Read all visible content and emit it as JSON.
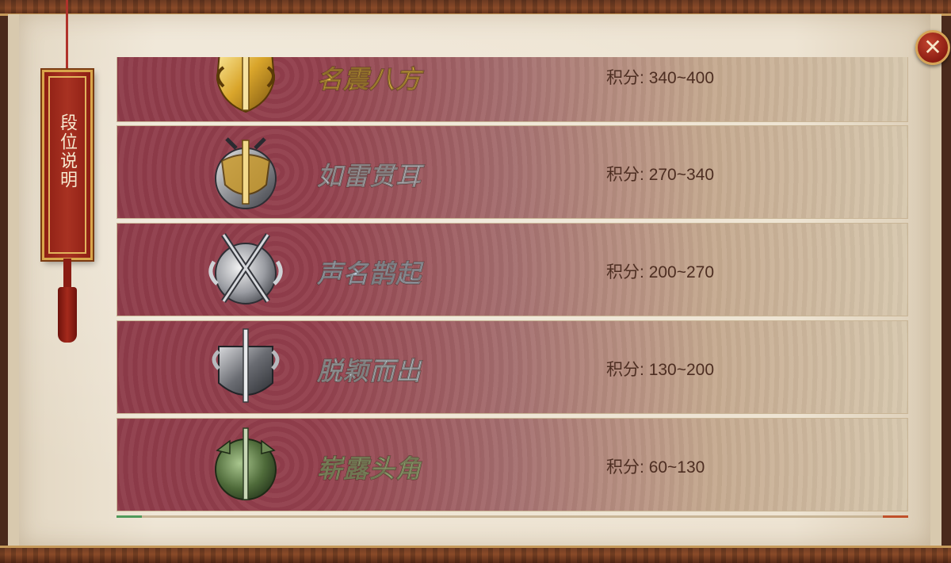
{
  "panel": {
    "title": "段位说明",
    "close_label": "✕"
  },
  "ranks": [
    {
      "name": "名震八方",
      "score_label": "积分:",
      "score_range": "340~400",
      "tier": "gold"
    },
    {
      "name": "如雷贯耳",
      "score_label": "积分:",
      "score_range": "270~340",
      "tier": "silver-gold"
    },
    {
      "name": "声名鹊起",
      "score_label": "积分:",
      "score_range": "200~270",
      "tier": "silver"
    },
    {
      "name": "脱颖而出",
      "score_label": "积分:",
      "score_range": "130~200",
      "tier": "iron"
    },
    {
      "name": "崭露头角",
      "score_label": "积分:",
      "score_range": "60~130",
      "tier": "jade"
    }
  ],
  "colors": {
    "gold": "#f2c54a",
    "silver-gold": "#dfe6f2",
    "silver": "#cfe2f6",
    "iron": "#d7e8f3",
    "jade": "#b9d89a"
  }
}
